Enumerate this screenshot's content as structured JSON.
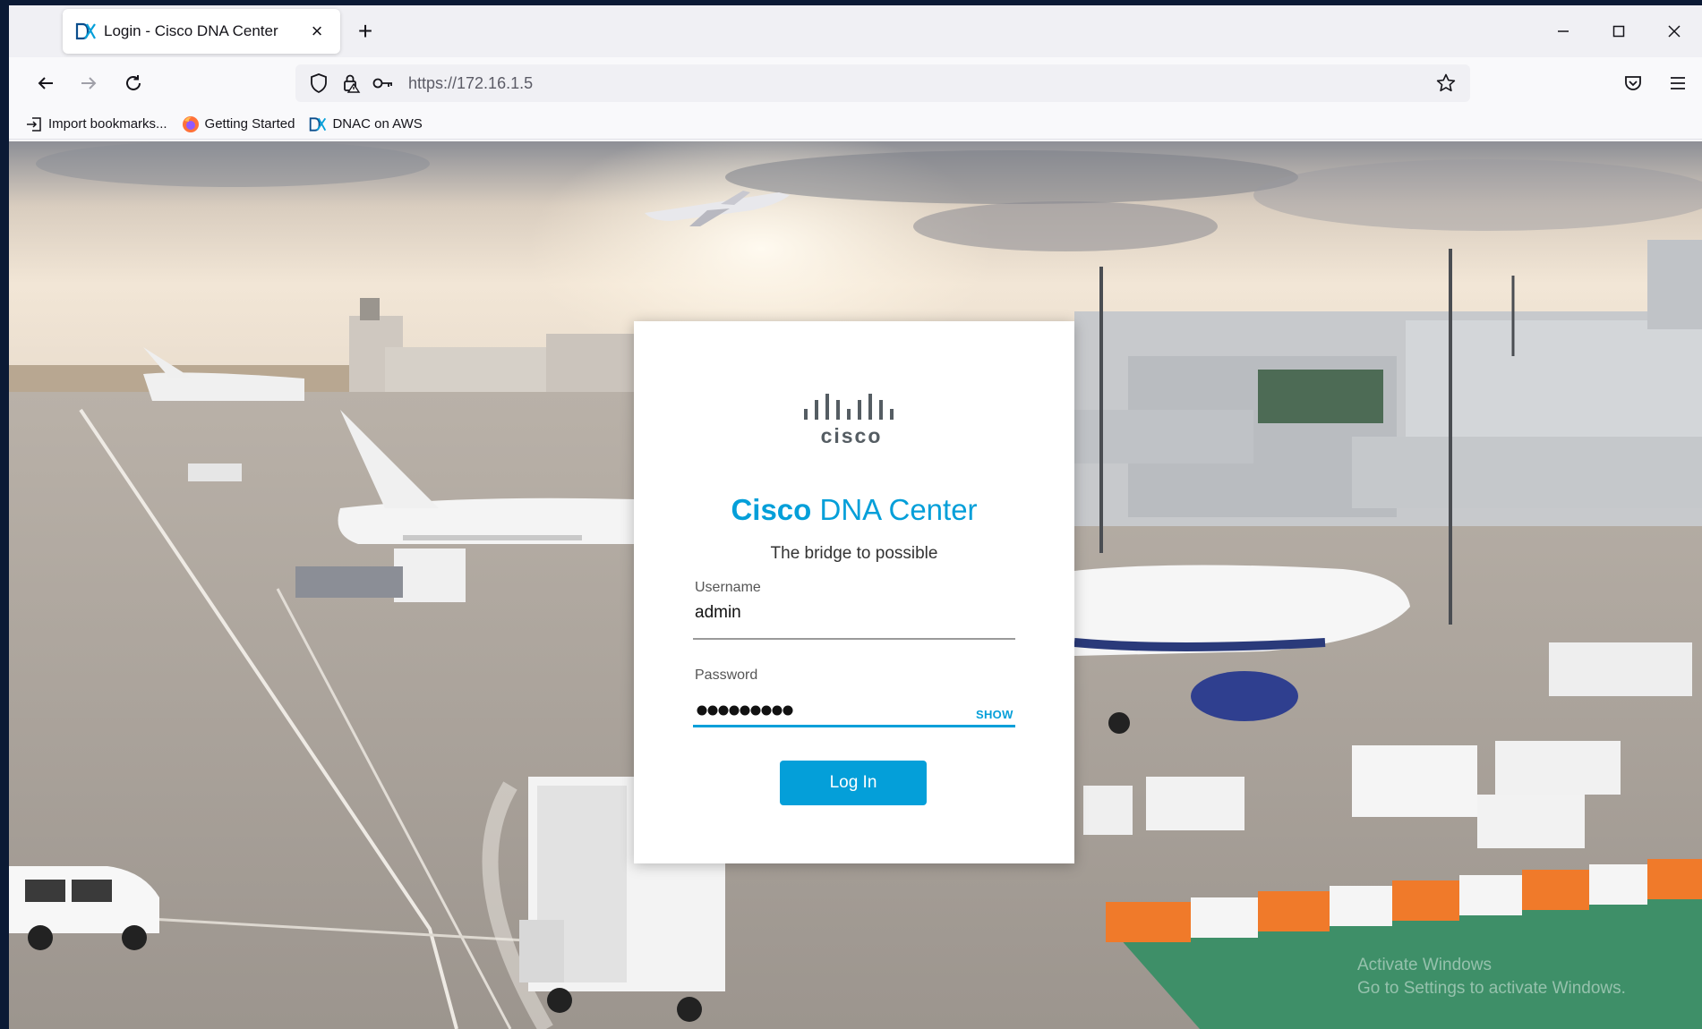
{
  "browser": {
    "tab": {
      "title": "Login - Cisco DNA Center",
      "close_icon": "close-icon"
    },
    "new_tab_label": "+",
    "window_controls": {
      "minimize": "─",
      "maximize": "☐",
      "close": "✕"
    },
    "url": "https://172.16.1.5",
    "bookmarks": [
      {
        "label": "Import bookmarks...",
        "icon": "import-icon"
      },
      {
        "label": "Getting Started",
        "icon": "firefox-icon"
      },
      {
        "label": "DNAC on AWS",
        "icon": "cisco-dna-icon"
      }
    ]
  },
  "login": {
    "logo_text": "cisco",
    "title_bold": "Cisco",
    "title_rest": " DNA Center",
    "tagline": "The bridge to possible",
    "username_label": "Username",
    "username_value": "admin",
    "password_label": "Password",
    "password_length": 9,
    "show_label": "SHOW",
    "login_button": "Log In"
  },
  "watermark": {
    "line1": "Activate Windows",
    "line2": "Go to Settings to activate Windows."
  },
  "colors": {
    "cisco_blue": "#049fd9",
    "frame": "#0b1a35"
  }
}
